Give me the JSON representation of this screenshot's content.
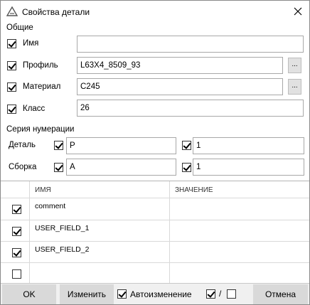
{
  "window": {
    "title": "Свойства детали",
    "close_icon": "close-icon"
  },
  "general": {
    "legend": "Общие",
    "fields": [
      {
        "label": "Имя",
        "checked": true,
        "value": ""
      },
      {
        "label": "Профиль",
        "checked": true,
        "value": "L63X4_8509_93",
        "button": "..."
      },
      {
        "label": "Материал",
        "checked": true,
        "value": "C245",
        "button": "..."
      },
      {
        "label": "Класс",
        "checked": true,
        "value": "26"
      }
    ]
  },
  "numbering": {
    "legend": "Серия нумерации",
    "part": {
      "label": "Деталь",
      "prefix": "P",
      "start": "1"
    },
    "assembly": {
      "label": "Сборка",
      "prefix": "A",
      "start": "1"
    }
  },
  "grid": {
    "columns": [
      "ИМЯ",
      "ЗНАЧЕНИЕ"
    ],
    "rows": [
      {
        "checked": true,
        "name": "comment",
        "value": ""
      },
      {
        "checked": true,
        "name": "USER_FIELD_1",
        "value": ""
      },
      {
        "checked": true,
        "name": "USER_FIELD_2",
        "value": ""
      },
      {
        "checked": false,
        "name": "",
        "value": ""
      }
    ]
  },
  "footer": {
    "ok": "OK",
    "modify": "Изменить",
    "auto_modify": "Автоизменение",
    "toggle_separator": "/",
    "cancel": "Отмена"
  }
}
